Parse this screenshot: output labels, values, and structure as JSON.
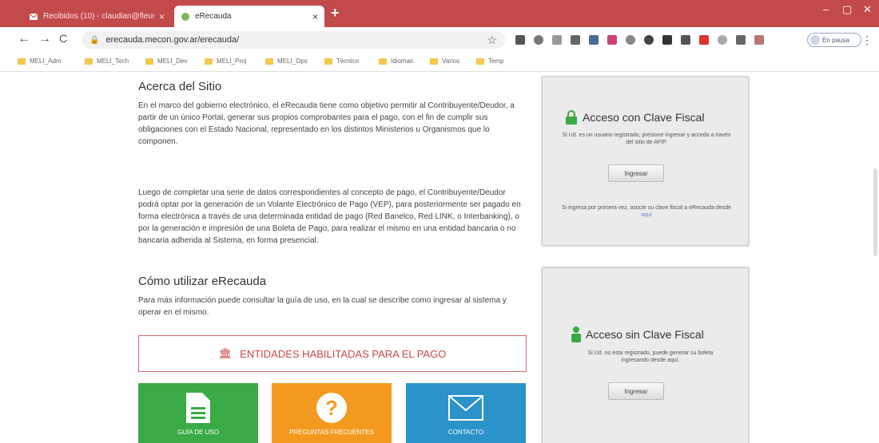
{
  "browser": {
    "tabs": [
      {
        "label": "Recibidos (10) - claudian@fleur"
      },
      {
        "label": "eRecauda"
      }
    ],
    "tab_close": "×",
    "new_tab": "+",
    "window_controls": {
      "minimize": "–",
      "maximize": "▢",
      "close": "✕"
    },
    "nav": {
      "back": "←",
      "forward": "→",
      "reload": "C"
    },
    "url": "erecauda.mecon.gov.ar/erecauda/",
    "profile_status": "En pausa",
    "bookmarks": [
      "MELI_Adm",
      "MELI_Tech",
      "MELI_Dev",
      "MELI_Proj",
      "MELI_Ops",
      "Técnico",
      "Idiomas",
      "Varios",
      "Temp"
    ],
    "accent": "#c24a4a"
  },
  "main": {
    "about": {
      "title": "Acerca del Sitio",
      "p1": "En el marco del gobierno electrónico, el eRecauda tiene como objetivo permitir al Contribuyente/Deudor, a partir de un único Portal, generar sus propios comprobantes para el pago, con el fin de cumplir sus obligaciones con el Estado Nacional, representado en los distintos Ministerios u Organismos que lo componen.",
      "p2": "Luego de completar una serie de datos correspondientes al concepto de pago, el Contribuyente/Deudor podrá optar por la generación de un Volante Electrónico de Pago (VEP), para posteriormente ser pagado en forma electrónica a través de una determinada entidad de pago (Red Banelco, Red LINK, o Interbanking), o por la generación e impresión de una Boleta de Pago, para realizar el mismo en una entidad bancaria o no bancaria adherida al Sistema, en forma presencial."
    },
    "howto": {
      "title": "Cómo utilizar eRecauda",
      "p": "Para más información puede consultar la guía de uso, en la cual se describe como ingresar al sistema y operar en el mismo."
    },
    "entidades_button": "ENTIDADES HABILITADAS PARA EL PAGO",
    "tiles": [
      {
        "label": "GUÍA DE USO",
        "color": "#3aaa45"
      },
      {
        "label": "PREGUNTAS FRECUENTES",
        "color": "#f39a1e"
      },
      {
        "label": "CONTACTO",
        "color": "#2a93c9"
      }
    ]
  },
  "cards": {
    "con_clave": {
      "title": "Acceso con Clave Fiscal",
      "text": "Si Ud. es un usuario registrado, presione ingresar y acceda a través del sitio de AFIP.",
      "button": "Ingresar",
      "note": "Si ingresa por primera vez, asocie su clave fiscal a eRecauda desde",
      "note_link": "aquí"
    },
    "sin_clave": {
      "title": "Acceso sin Clave Fiscal",
      "text": "Si Ud. no esta registrado, puede generar su boleta ingresando desde aquí.",
      "button": "Ingresar"
    }
  }
}
